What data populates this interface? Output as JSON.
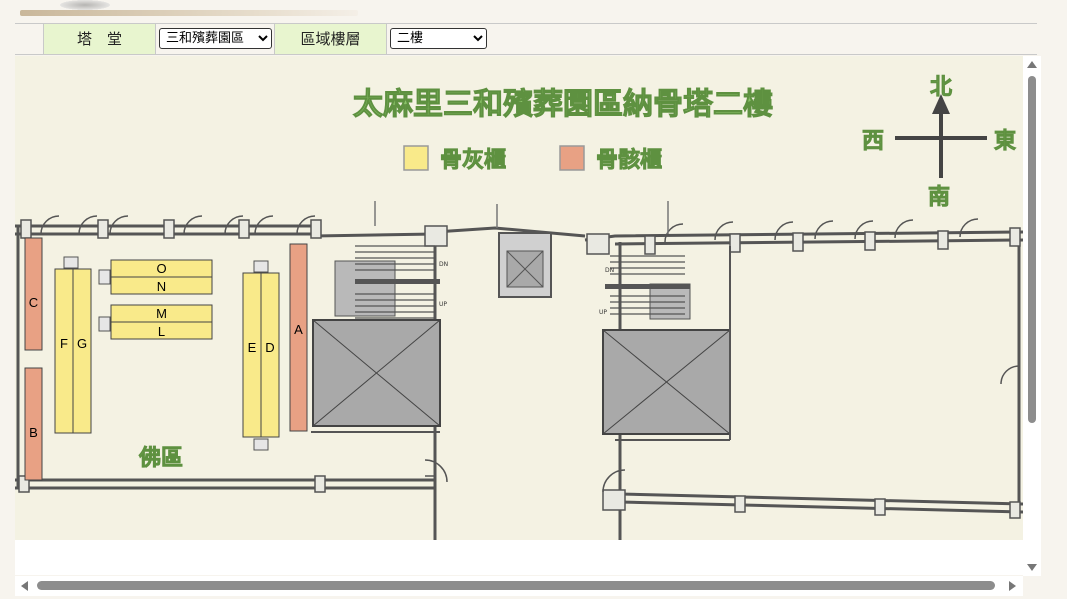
{
  "toolbar": {
    "tower_label": "塔　堂",
    "tower_selected": "三和殯葬園區",
    "area_label": "區域樓層",
    "floor_selected": "二樓"
  },
  "map": {
    "title": "太麻里三和殯葬園區納骨塔二樓",
    "legend": {
      "ash": "骨灰櫃",
      "bone": "骨骸櫃"
    },
    "compass": {
      "north": "北",
      "south": "南",
      "east": "東",
      "west": "西"
    },
    "zone_label": "佛區",
    "cabinets": [
      "A",
      "B",
      "C",
      "D",
      "E",
      "F",
      "G",
      "L",
      "M",
      "N",
      "O"
    ],
    "stair_marks": [
      "DN",
      "UP",
      "DN",
      "UP"
    ],
    "colors": {
      "ash": "#f9ea8a",
      "bone": "#e8a184",
      "label_green": "#7fb560",
      "floor": "#f4f2e3"
    }
  }
}
